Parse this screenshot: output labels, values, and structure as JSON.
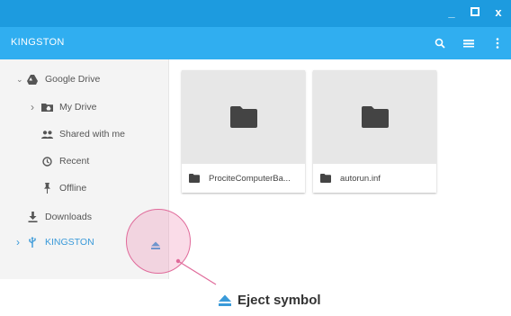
{
  "window": {
    "minimize_glyph": "_",
    "maximize_glyph": "□",
    "close_glyph": "x"
  },
  "toolbar": {
    "title": "KINGSTON",
    "icons": [
      "search-icon",
      "view-list-icon",
      "more-vert-icon"
    ]
  },
  "sidebar": {
    "items": [
      {
        "label": "Google Drive",
        "icon": "google-drive-icon",
        "expander": "⌄"
      },
      {
        "label": "My Drive",
        "icon": "my-drive-icon",
        "expander": "›"
      },
      {
        "label": "Shared with me",
        "icon": "people-icon"
      },
      {
        "label": "Recent",
        "icon": "clock-icon"
      },
      {
        "label": "Offline",
        "icon": "pin-icon"
      },
      {
        "label": "Downloads",
        "icon": "download-icon"
      },
      {
        "label": "KINGSTON",
        "icon": "usb-icon",
        "expander": "›",
        "active": true
      }
    ]
  },
  "files": [
    {
      "name": "ProciteComputerBa...",
      "icon": "folder-icon"
    },
    {
      "name": "autorun.inf",
      "icon": "folder-icon"
    }
  ],
  "annotation": {
    "label": "Eject symbol"
  },
  "colors": {
    "titlebar": "#1d9bdf",
    "toolbar": "#30aef0",
    "active": "#3a9ad9",
    "highlight": "#e06a9a"
  }
}
